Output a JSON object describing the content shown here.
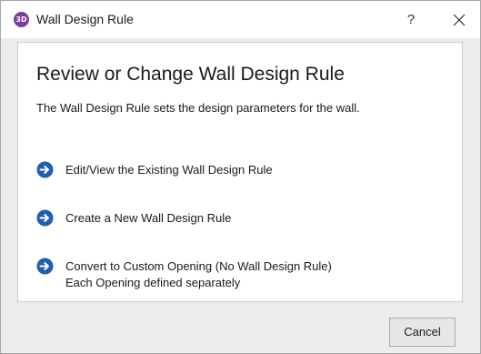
{
  "window": {
    "app_icon_text": "3D",
    "title": "Wall Design Rule",
    "help_label": "?"
  },
  "main": {
    "heading": "Review or Change Wall Design Rule",
    "description": "The Wall Design Rule sets the design parameters for the wall.",
    "options": [
      {
        "label": "Edit/View the Existing  Wall Design Rule",
        "sublabel": ""
      },
      {
        "label": "Create a New  Wall Design Rule",
        "sublabel": ""
      },
      {
        "label": "Convert to Custom Opening (No Wall Design Rule)",
        "sublabel": "Each Opening defined separately"
      }
    ]
  },
  "footer": {
    "cancel_label": "Cancel"
  },
  "colors": {
    "accent_blue": "#1f5fad",
    "app_icon": "#7b3fa0"
  },
  "icons": {
    "option_icon": "arrow-circle-right-icon",
    "close_icon": "close-icon",
    "help_icon": "help-icon"
  }
}
